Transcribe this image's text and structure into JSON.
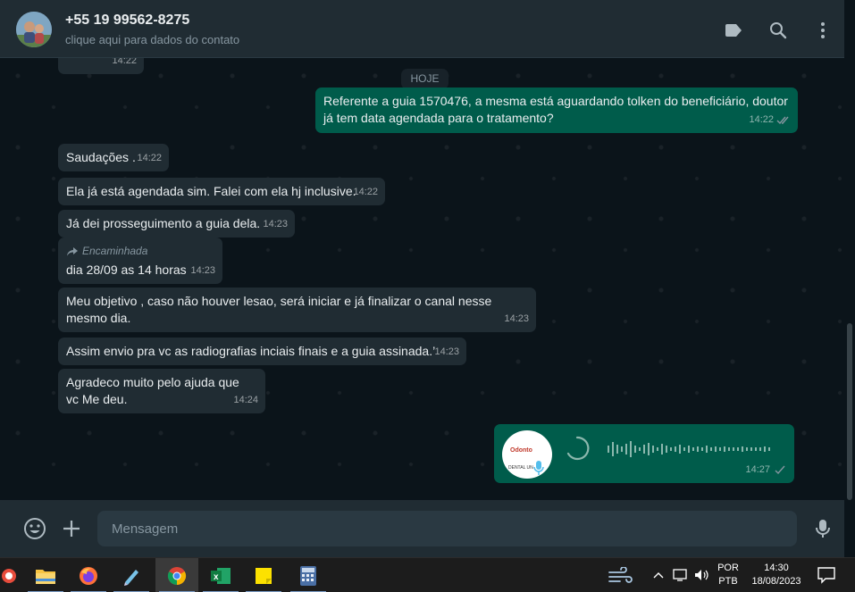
{
  "header": {
    "contact_name": "+55 19 99562-8275",
    "contact_subtitle": "clique aqui para dados do contato"
  },
  "chat": {
    "partial_time": "14:22",
    "date_label": "HOJE",
    "messages": [
      {
        "dir": "out",
        "text": "Referente a guia 1570476, a mesma está aguardando tolken do beneficiário, doutor já tem data agendada para o tratamento?",
        "time": "14:22"
      },
      {
        "dir": "in",
        "text": "Saudações .",
        "time": "14:22"
      },
      {
        "dir": "in",
        "text": "Ela já está agendada sim. Falei com ela hj inclusive.",
        "time": "14:22"
      },
      {
        "dir": "in",
        "text": "Já dei prosseguimento a guia dela.",
        "time": "14:23"
      },
      {
        "dir": "in",
        "forwarded": "Encaminhada",
        "text": "dia 28/09 as 14 horas",
        "time": "14:23"
      },
      {
        "dir": "in",
        "text": "Meu objetivo , caso não houver lesao, será iniciar e já finalizar o canal nesse mesmo dia.",
        "time": "14:23"
      },
      {
        "dir": "in",
        "text": "Assim envio pra vc as radiografias inciais finais e a guia assinada.’",
        "time": "14:23"
      },
      {
        "dir": "in",
        "text": "Agradeco muito pelo ajuda que vc Me deu.",
        "time": "14:24"
      }
    ],
    "voice": {
      "time": "14:27",
      "logo_top": "Odonto",
      "logo_bottom": "DENTAL UN"
    }
  },
  "footer": {
    "input_placeholder": "Mensagem"
  },
  "taskbar": {
    "lang_top": "POR",
    "lang_bottom": "PTB",
    "clock_time": "14:30",
    "clock_date": "18/08/2023"
  }
}
